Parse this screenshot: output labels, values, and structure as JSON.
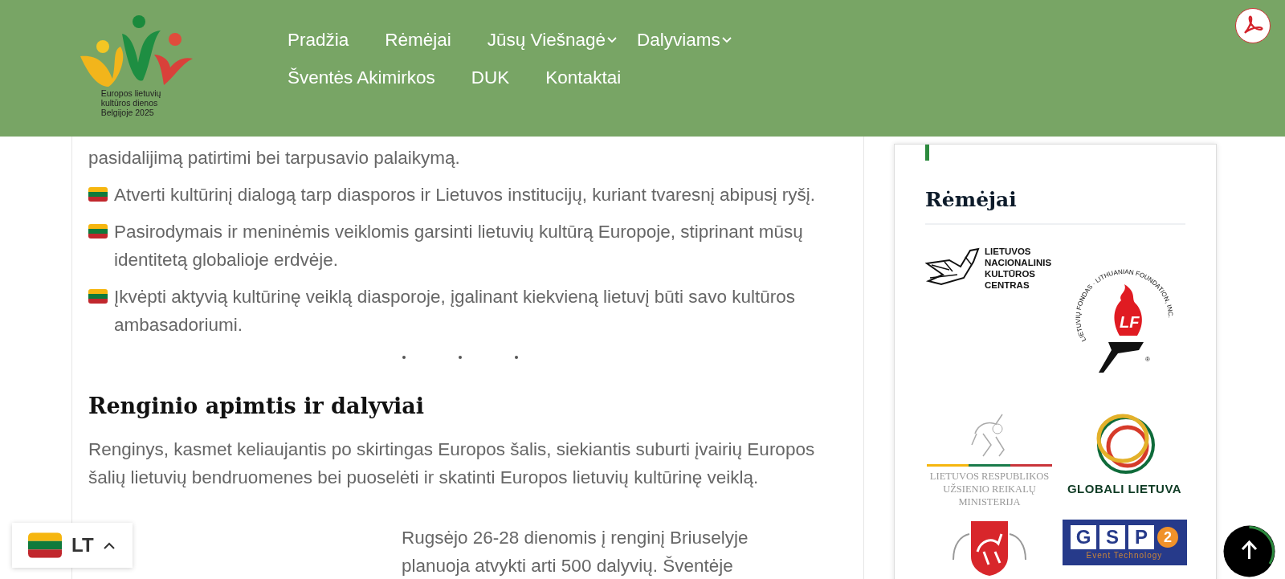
{
  "header": {
    "logo_caption": [
      "Europos lietuvių",
      "kultūros dienos",
      "Belgijoje 2025"
    ],
    "nav": [
      {
        "label": "Pradžia",
        "has_submenu": false
      },
      {
        "label": "Rėmėjai",
        "has_submenu": false
      },
      {
        "label": "Jūsų Viešnagė",
        "has_submenu": true
      },
      {
        "label": "Dalyviams",
        "has_submenu": true
      },
      {
        "label": "Šventės Akimirkos",
        "has_submenu": false
      },
      {
        "label": "DUK",
        "has_submenu": false
      },
      {
        "label": "Kontaktai",
        "has_submenu": false
      }
    ]
  },
  "article": {
    "paragraphs": [
      {
        "kind": "text",
        "text": "pasidalijimą patirtimi bei tarpusavio palaikymą."
      },
      {
        "kind": "flag",
        "text": "Atverti kultūrinį dialogą tarp diasporos ir Lietuvos institucijų, kuriant tvaresnį abipusį ryšį."
      },
      {
        "kind": "flag",
        "text": "Pasirodymais ir meninėmis veiklomis garsinti lietuvių kultūrą Europoje, stiprinant mūsų identitetą globalioje erdvėje."
      },
      {
        "kind": "flag",
        "text": "Įkvėpti aktyvią kultūrinę veiklą diasporoje, įgalinant kiekvieną lietuvį būti savo kultūros ambasadoriumi."
      }
    ],
    "heading": "Renginio apimtis ir dalyviai",
    "intro": "Renginys, kasmet keliaujantis po skirtingas Europos šalis, siekiantis suburti įvairių Europos šalių lietuvių bendruomenes bei puoselėti ir skatinti Europos lietuvių kultūrinę veiklą.",
    "side_text": "Rugsėjo 26-28 dienomis į renginį Briuselyje planuoja atvykti arti 500 dalyvių. Šventėje"
  },
  "sidebar": {
    "title": "Rėmėjai",
    "sponsors": [
      {
        "kind": "lnkc",
        "lines": [
          "LIETUVOS",
          "NACIONALINIS",
          "KULTŪROS",
          "CENTRAS"
        ]
      },
      {
        "kind": "lf",
        "ring": "LIETUVIŲ FONDAS · LITHUANIAN FOUNDATION, INC.",
        "initials": "LF",
        "mark": "®"
      },
      {
        "kind": "urm",
        "lines": [
          "LIETUVOS RESPUBLIKOS",
          "UŽSIENIO REIKALŲ",
          "MINISTERIJA"
        ]
      },
      {
        "kind": "globali",
        "lines": [
          "GLOBALI LIETUVA"
        ]
      },
      {
        "kind": "coat"
      },
      {
        "kind": "gsp",
        "letters": [
          "G",
          "S",
          "P",
          "2"
        ],
        "sub": "Event Technology"
      }
    ]
  },
  "language": {
    "code": "LT"
  }
}
